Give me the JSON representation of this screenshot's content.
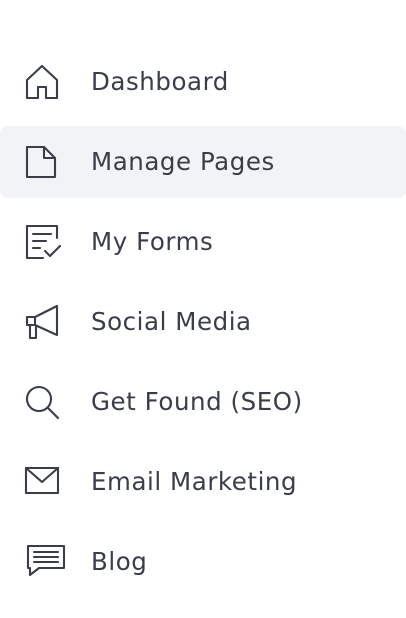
{
  "nav": {
    "items": [
      {
        "label": "Dashboard",
        "icon": "home-icon"
      },
      {
        "label": "Manage Pages",
        "icon": "page-icon",
        "active": true
      },
      {
        "label": "My Forms",
        "icon": "form-check-icon"
      },
      {
        "label": "Social Media",
        "icon": "megaphone-icon"
      },
      {
        "label": "Get Found (SEO)",
        "icon": "search-icon"
      },
      {
        "label": "Email Marketing",
        "icon": "envelope-icon"
      },
      {
        "label": "Blog",
        "icon": "chat-bubble-icon"
      }
    ]
  },
  "colors": {
    "text": "#3a3e48",
    "active_background": "#f1f3f6",
    "background": "#ffffff"
  }
}
